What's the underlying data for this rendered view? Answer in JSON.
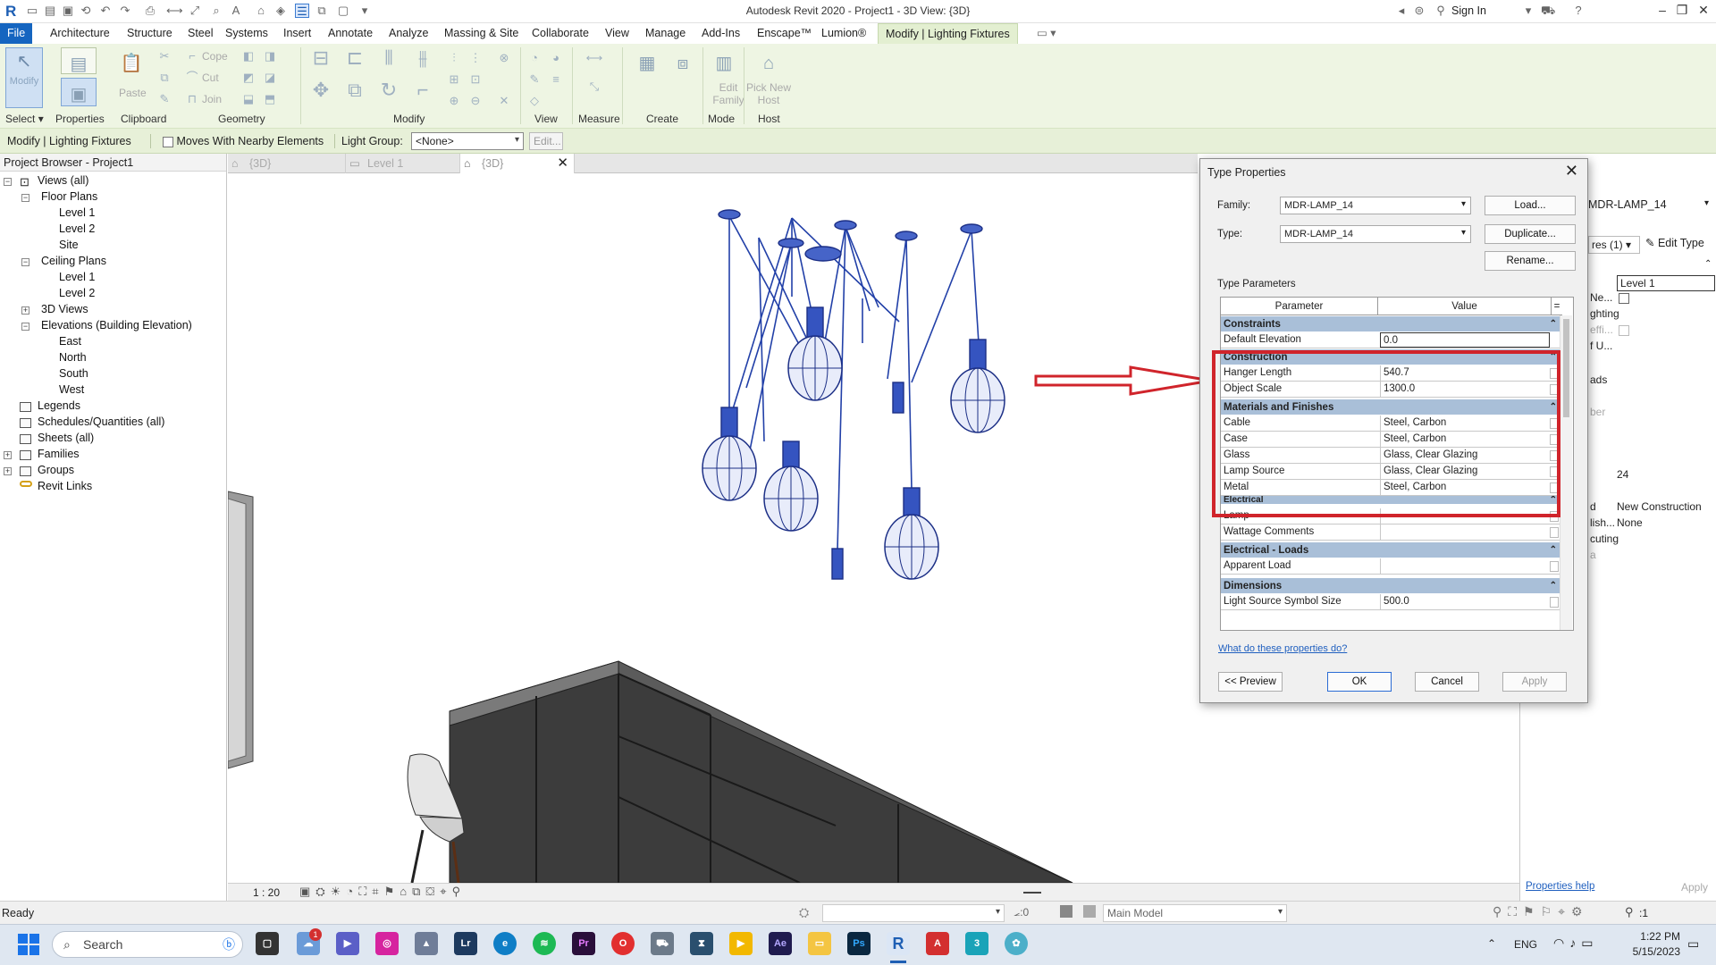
{
  "titlebar": {
    "title": "Autodesk Revit 2020 - Project1 - 3D View: {3D}",
    "sign_in": "Sign In"
  },
  "ribbon_tabs": [
    "File",
    "Architecture",
    "Structure",
    "Steel",
    "Systems",
    "Insert",
    "Annotate",
    "Analyze",
    "Massing & Site",
    "Collaborate",
    "View",
    "Manage",
    "Add-Ins",
    "Enscape™",
    "Lumion®",
    "Modify | Lighting Fixtures"
  ],
  "ribbon": {
    "modify": "Modify",
    "paste": "Paste",
    "cope": "Cope",
    "cut": "Cut",
    "join": "Join",
    "edit_family": "Edit Family",
    "pick_new_host": "Pick New Host",
    "groups": [
      "Select",
      "Properties",
      "Clipboard",
      "Geometry",
      "Modify",
      "View",
      "Measure",
      "Create",
      "Mode",
      "Host"
    ]
  },
  "options_bar": {
    "context": "Modify | Lighting Fixtures",
    "moves_with": "Moves With Nearby Elements",
    "light_group_label": "Light Group:",
    "light_group_value": "<None>",
    "edit": "Edit..."
  },
  "browser": {
    "title": "Project Browser - Project1",
    "nodes": [
      {
        "label": "Views (all)"
      },
      {
        "label": "Floor Plans"
      },
      {
        "label": "Level 1"
      },
      {
        "label": "Level 2"
      },
      {
        "label": "Site"
      },
      {
        "label": "Ceiling Plans"
      },
      {
        "label": "Level 1"
      },
      {
        "label": "Level 2"
      },
      {
        "label": "3D Views"
      },
      {
        "label": "Elevations (Building Elevation)"
      },
      {
        "label": "East"
      },
      {
        "label": "North"
      },
      {
        "label": "South"
      },
      {
        "label": "West"
      },
      {
        "label": "Legends"
      },
      {
        "label": "Schedules/Quantities (all)"
      },
      {
        "label": "Sheets (all)"
      },
      {
        "label": "Families"
      },
      {
        "label": "Groups"
      },
      {
        "label": "Revit Links"
      }
    ]
  },
  "view_tabs": [
    "{3D}",
    "Level 1",
    "{3D}"
  ],
  "view_scale": "1 : 20",
  "dialog": {
    "title": "Type Properties",
    "family_label": "Family:",
    "family_value": "MDR-LAMP_14",
    "type_label": "Type:",
    "type_value": "MDR-LAMP_14",
    "load": "Load...",
    "duplicate": "Duplicate...",
    "rename": "Rename...",
    "type_parameters": "Type Parameters",
    "col_parameter": "Parameter",
    "col_value": "Value",
    "col_eq": "=",
    "groups": [
      {
        "name": "Constraints",
        "rows": [
          {
            "name": "Default Elevation",
            "value": "0.0"
          }
        ]
      },
      {
        "name": "Construction",
        "rows": [
          {
            "name": "Hanger Length",
            "value": "540.7"
          },
          {
            "name": "Object Scale",
            "value": "1300.0"
          }
        ]
      },
      {
        "name": "Materials and Finishes",
        "rows": [
          {
            "name": "Cable",
            "value": "Steel, Carbon"
          },
          {
            "name": "Case",
            "value": "Steel, Carbon"
          },
          {
            "name": "Glass",
            "value": "Glass, Clear Glazing"
          },
          {
            "name": "Lamp Source",
            "value": "Glass, Clear Glazing"
          },
          {
            "name": "Metal",
            "value": "Steel, Carbon"
          }
        ]
      },
      {
        "name": "Electrical",
        "rows": [
          {
            "name": "Lamp",
            "value": ""
          },
          {
            "name": "Wattage Comments",
            "value": ""
          }
        ]
      },
      {
        "name": "Electrical - Loads",
        "rows": [
          {
            "name": "Apparent Load",
            "value": ""
          }
        ]
      },
      {
        "name": "Dimensions",
        "rows": [
          {
            "name": "Light Source Symbol Size",
            "value": "500.0"
          }
        ]
      }
    ],
    "help": "What do these properties do?",
    "preview": "<< Preview",
    "ok": "OK",
    "cancel": "Cancel",
    "apply": "Apply"
  },
  "properties_palette": {
    "type_name": "MDR-LAMP_14",
    "selector": "res (1)",
    "edit_type": "Edit Type",
    "level": "Level 1",
    "rows": [
      "Ne...",
      "ghting",
      "effi...",
      "f U...",
      "ads",
      "ber",
      "24",
      "d",
      "lish...",
      "cuting",
      "a"
    ],
    "phase_created": "New Construction",
    "phase_demolished": "None",
    "help": "Properties help",
    "apply": "Apply"
  },
  "status": {
    "ready": "Ready",
    "angle": ":0",
    "model": "Main Model",
    "filter": ":1"
  },
  "taskbar": {
    "search": "Search",
    "lang": "ENG",
    "time": "1:22 PM",
    "date": "5/15/2023",
    "badge": "1"
  },
  "colors": {
    "file_tab": "#1565c0",
    "ribbon_bg": "#eef5e3",
    "highlight": "#d0242b",
    "lamp_blue": "#2240a8"
  }
}
